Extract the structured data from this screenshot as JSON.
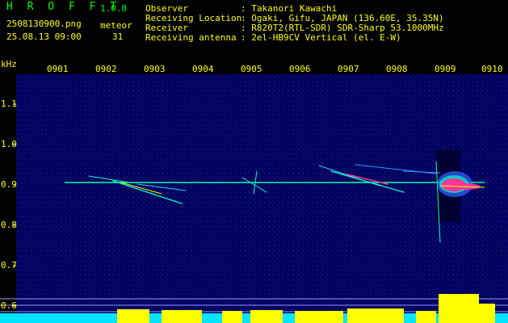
{
  "header": {
    "app_name": "H R O F F T",
    "version": "1.0.0",
    "filename": "2508130900.png",
    "datetime": "25.08.13 09:00",
    "meteor_label": "meteor",
    "meteor_count": "31",
    "observer_label": "Observer",
    "observer": ": Takanori Kawachi",
    "location_label": "Receiving Location",
    "location": ": Ogaki, Gifu, JAPAN (136.60E, 35.35N)",
    "receiver_label": "Receiver",
    "receiver": ": R820T2(RTL-SDR) SDR-Sharp 53.1000MHz",
    "antenna_label": "Receiving antenna",
    "antenna": ": 2el-HB9CV Vertical (el. E-W)"
  },
  "axis": {
    "unit": "kHz",
    "time_ticks": [
      "0901",
      "0902",
      "0903",
      "0904",
      "0905",
      "0906",
      "0907",
      "0908",
      "0909",
      "0910"
    ],
    "freq_ticks": [
      "1.1",
      "1.0",
      "0.9",
      "0.8",
      "0.7",
      "0.6"
    ]
  },
  "colors": {
    "header_label": "#ffff00",
    "header_green": "#00ff00",
    "background": "#000080",
    "signal_green": "#00ff99",
    "hot": "#ff3399",
    "level_cyan": "#00e5ff",
    "level_yellow": "#ffff00"
  }
}
